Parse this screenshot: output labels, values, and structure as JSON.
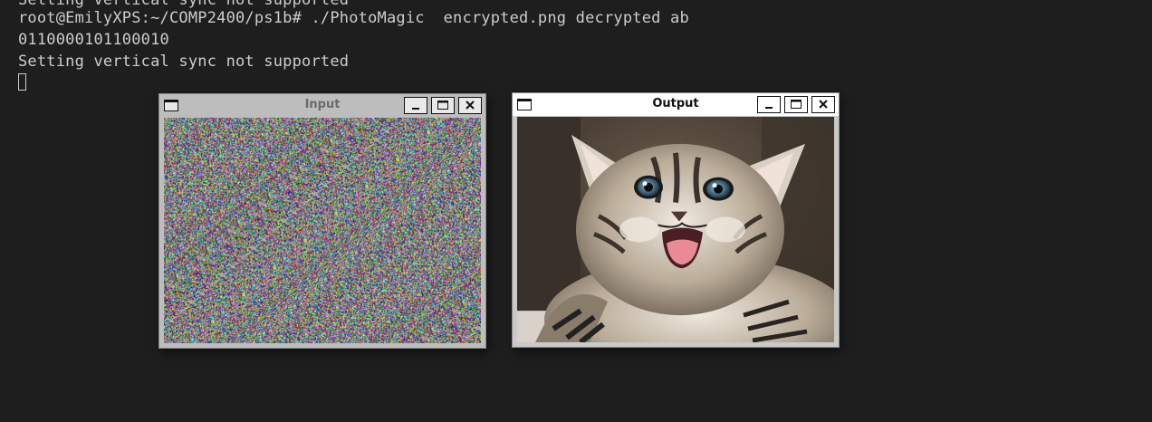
{
  "terminal": {
    "lines": [
      "Setting vertical sync not supported",
      "root@EmilyXPS:~/COMP2400/ps1b# ./PhotoMagic  encrypted.png decrypted ab",
      "0110000101100010",
      "Setting vertical sync not supported"
    ]
  },
  "windows": {
    "input": {
      "title": "Input",
      "icons": {
        "menu": "window-menu-icon",
        "min": "minimize-icon",
        "max": "maximize-icon",
        "close": "close-icon"
      }
    },
    "output": {
      "title": "Output",
      "icons": {
        "menu": "window-menu-icon",
        "min": "minimize-icon",
        "max": "maximize-icon",
        "close": "close-icon"
      }
    }
  },
  "colors": {
    "terminal_bg": "#1e1e1e",
    "terminal_fg": "#cccccc",
    "active_titlebar": "#ffffff",
    "inactive_titlebar": "#bdbdbd"
  }
}
